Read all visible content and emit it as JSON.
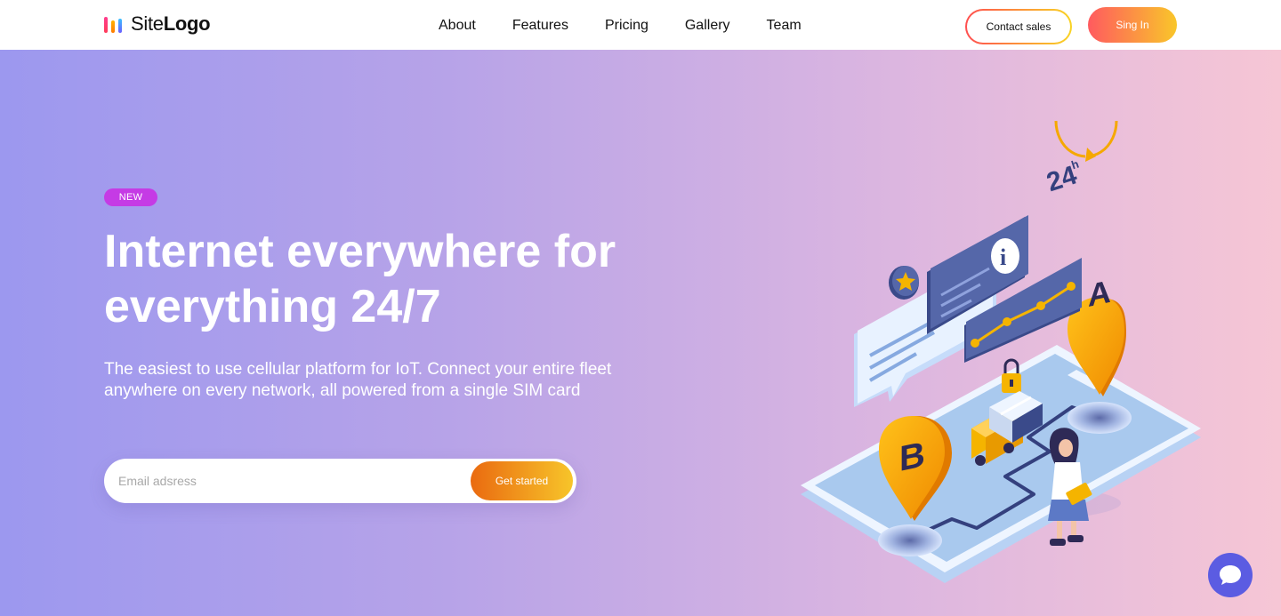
{
  "header": {
    "logo_light": "Site",
    "logo_bold": "Logo",
    "nav": [
      "About",
      "Features",
      "Pricing",
      "Gallery",
      "Team"
    ],
    "contact_label": "Contact sales",
    "signin_label": "Sing In"
  },
  "hero": {
    "badge": "NEW",
    "headline_line1": "Internet everywhere for",
    "headline_line2": "everything 24/7",
    "subtext_line1": "The easiest to use cellular platform for IoT. Connect your entire fleet",
    "subtext_line2": "anywhere on every network, all powered from a single SIM card",
    "email_placeholder": "Email adsress",
    "cta_label": "Get started"
  },
  "illustration": {
    "pin_a": "A",
    "pin_b": "B",
    "clock_text": "24",
    "clock_suffix": "h",
    "info_glyph": "i"
  },
  "colors": {
    "badge": "#c53be5",
    "chat_button": "#5b5ce2",
    "cta_start": "#ea6a10",
    "cta_end": "#f7c52a"
  },
  "icons": [
    "logo-bars-icon",
    "star-icon",
    "info-icon",
    "lock-icon",
    "chat-bubble-icon"
  ]
}
